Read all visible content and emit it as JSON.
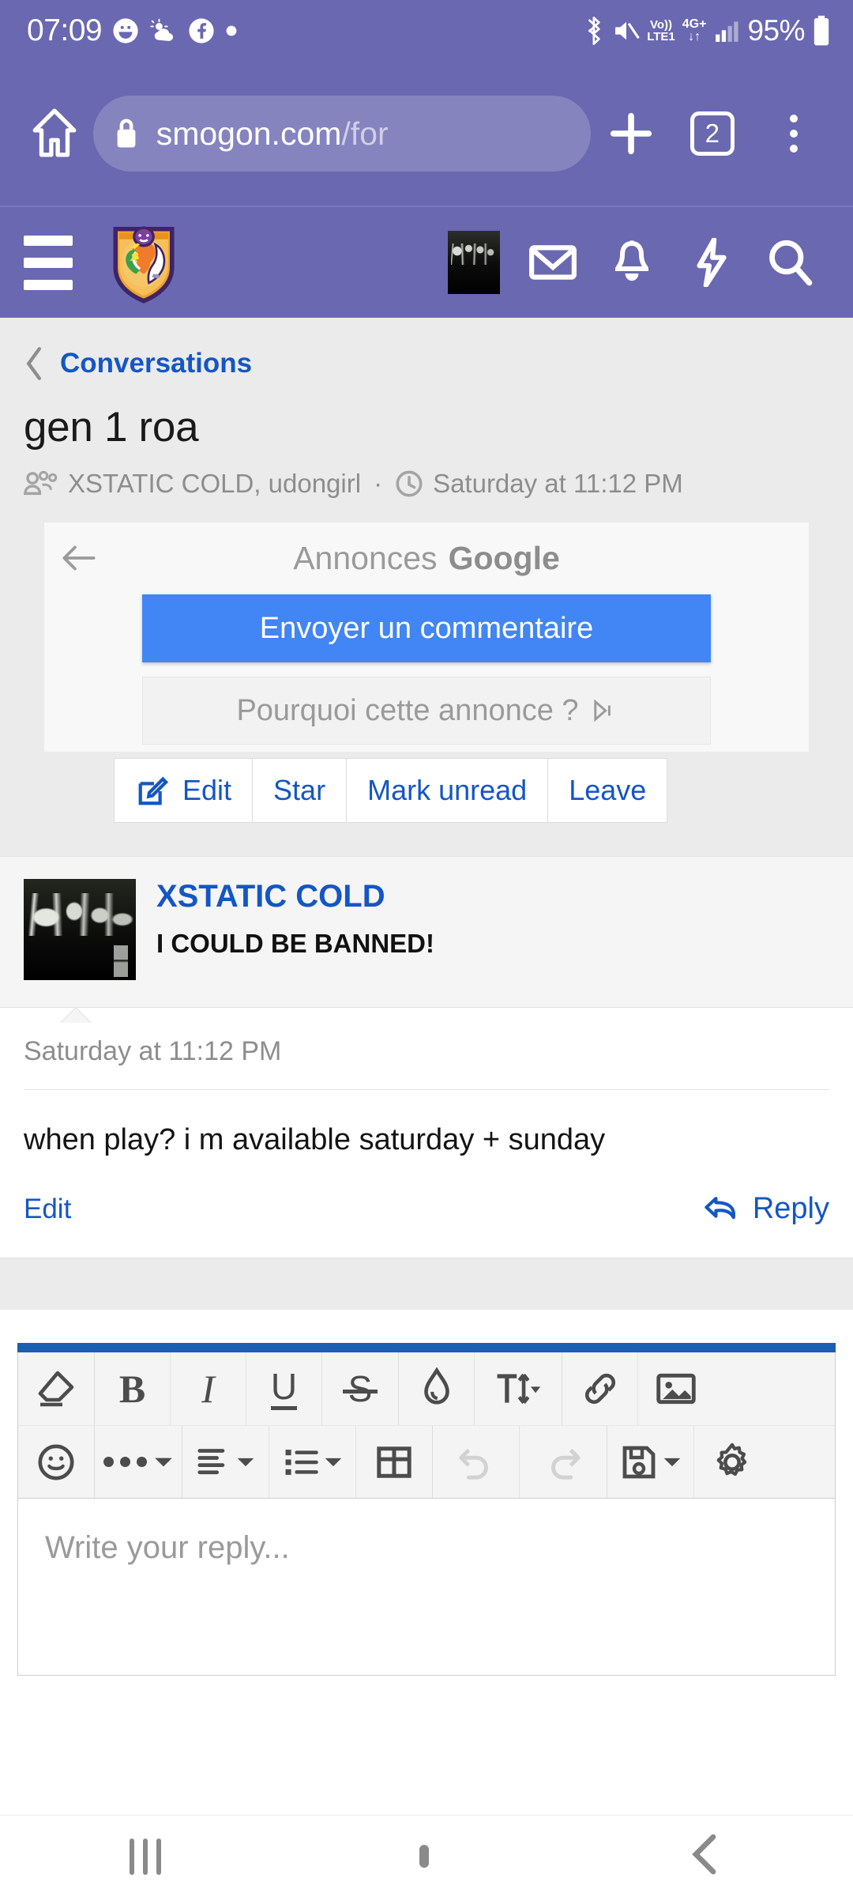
{
  "status_bar": {
    "clock": "07:09",
    "battery_pct": "95%",
    "network_voice": "Vo))",
    "network_band": "LTE1",
    "network_gen": "4G+",
    "icons": [
      "smiley-icon",
      "weather-icon",
      "facebook-icon",
      "dot-icon",
      "bluetooth-icon",
      "mute-icon",
      "signal-icon",
      "battery-icon"
    ]
  },
  "browser": {
    "url_visible": "smogon.com",
    "url_dim": "/for",
    "tab_count": "2",
    "lock_icon": "lock-icon",
    "home_icon": "home-icon",
    "new_tab_icon": "plus-icon",
    "menu_icon": "kebab-menu-icon"
  },
  "forum_nav": {
    "menu_icon": "hamburger-icon",
    "logo_icon": "smogon-shield-logo",
    "icons": [
      "user-avatar",
      "inbox-envelope-icon",
      "notification-bell-icon",
      "alerts-bolt-icon",
      "search-icon"
    ]
  },
  "breadcrumb": {
    "back_icon": "chevron-left-icon",
    "label": "Conversations"
  },
  "conversation": {
    "title": "gen 1 roa",
    "participants_icon": "participants-icon",
    "participants": "XSTATIC COLD, udongirl",
    "separator": "·",
    "clock_icon": "clock-icon",
    "time": "Saturday at 11:12 PM"
  },
  "ad": {
    "back_icon": "arrow-left-icon",
    "label": "Annonces",
    "brand": "Google",
    "primary_button": "Envoyer un commentaire",
    "secondary_button": "Pourquoi cette annonce ?",
    "secondary_icon": "adchoices-icon",
    "accent": "#4285f4"
  },
  "actions": [
    {
      "label": "Edit",
      "icon": "edit-pencil-icon"
    },
    {
      "label": "Star",
      "icon": ""
    },
    {
      "label": "Mark unread",
      "icon": ""
    },
    {
      "label": "Leave",
      "icon": ""
    }
  ],
  "message": {
    "avatar": "user-avatar-image",
    "username": "XSTATIC COLD",
    "user_title": "I COULD BE BANNED!",
    "date": "Saturday at 11:12 PM",
    "text": "when play? i m available saturday + sunday",
    "edit_label": "Edit",
    "reply_label": "Reply",
    "reply_icon": "reply-arrow-icon",
    "link_color": "#1456c4"
  },
  "editor": {
    "accent": "#1b5fb0",
    "placeholder": "Write your reply...",
    "row1": [
      {
        "icon": "eraser-icon",
        "glyph": "remove-format"
      },
      {
        "icon": "bold-icon",
        "glyph": "B"
      },
      {
        "icon": "italic-icon",
        "glyph": "I"
      },
      {
        "icon": "underline-icon",
        "glyph": "U"
      },
      {
        "icon": "strikethrough-icon",
        "glyph": "S"
      },
      {
        "icon": "text-color-drop-icon",
        "glyph": "drop"
      },
      {
        "icon": "font-size-icon",
        "glyph": "T-arrows",
        "has_caret": true
      },
      {
        "icon": "link-icon",
        "glyph": "link"
      },
      {
        "icon": "insert-image-icon",
        "glyph": "image"
      }
    ],
    "row2": [
      {
        "icon": "emoji-smiley-icon",
        "glyph": "smiley"
      },
      {
        "icon": "more-options-icon",
        "glyph": "dots",
        "has_caret": true
      },
      {
        "icon": "align-left-icon",
        "glyph": "align",
        "has_caret": true
      },
      {
        "icon": "bullet-list-icon",
        "glyph": "list",
        "has_caret": true
      },
      {
        "icon": "insert-table-icon",
        "glyph": "table"
      },
      {
        "icon": "undo-icon",
        "glyph": "undo",
        "disabled": true
      },
      {
        "icon": "redo-icon",
        "glyph": "redo",
        "disabled": true
      },
      {
        "icon": "save-draft-icon",
        "glyph": "floppy",
        "has_caret": true
      },
      {
        "icon": "settings-gear-icon",
        "glyph": "gear"
      }
    ]
  },
  "android_nav": {
    "recents_icon": "recents-icon",
    "home_icon": "home-square-icon",
    "back_icon": "back-chevron-icon"
  }
}
